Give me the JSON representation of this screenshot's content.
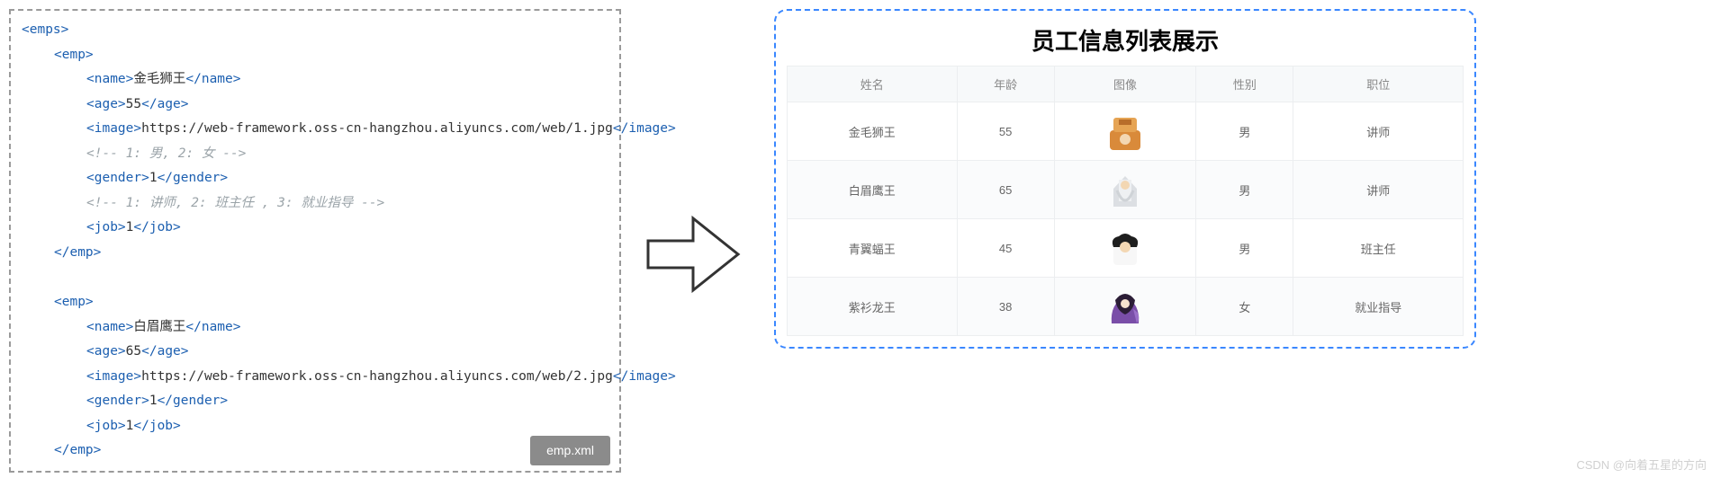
{
  "xml": {
    "filename_label": "emp.xml",
    "root_open": "<emps>",
    "emp_open": "<emp>",
    "emp_close": "</emp>",
    "name_tag": "name",
    "age_tag": "age",
    "image_tag": "image",
    "gender_tag": "gender",
    "job_tag": "job",
    "emp1": {
      "name": "金毛狮王",
      "age": "55",
      "image": "https://web-framework.oss-cn-hangzhou.aliyuncs.com/web/1.jpg",
      "comment_gender": "<!-- 1: 男, 2: 女 -->",
      "gender": "1",
      "comment_job": "<!-- 1: 讲师, 2: 班主任 , 3: 就业指导 -->",
      "job": "1"
    },
    "emp2": {
      "name": "白眉鹰王",
      "age": "65",
      "image": "https://web-framework.oss-cn-hangzhou.aliyuncs.com/web/2.jpg",
      "gender": "1",
      "job": "1"
    }
  },
  "table": {
    "title": "员工信息列表展示",
    "headers": [
      "姓名",
      "年龄",
      "图像",
      "性别",
      "职位"
    ],
    "rows": [
      {
        "name": "金毛狮王",
        "age": "55",
        "avatar": "a1",
        "gender": "男",
        "job": "讲师"
      },
      {
        "name": "白眉鹰王",
        "age": "65",
        "avatar": "a2",
        "gender": "男",
        "job": "讲师"
      },
      {
        "name": "青翼蝠王",
        "age": "45",
        "avatar": "a3",
        "gender": "男",
        "job": "班主任"
      },
      {
        "name": "紫衫龙王",
        "age": "38",
        "avatar": "a4",
        "gender": "女",
        "job": "就业指导"
      }
    ]
  },
  "watermark": "CSDN @向着五星的方向"
}
